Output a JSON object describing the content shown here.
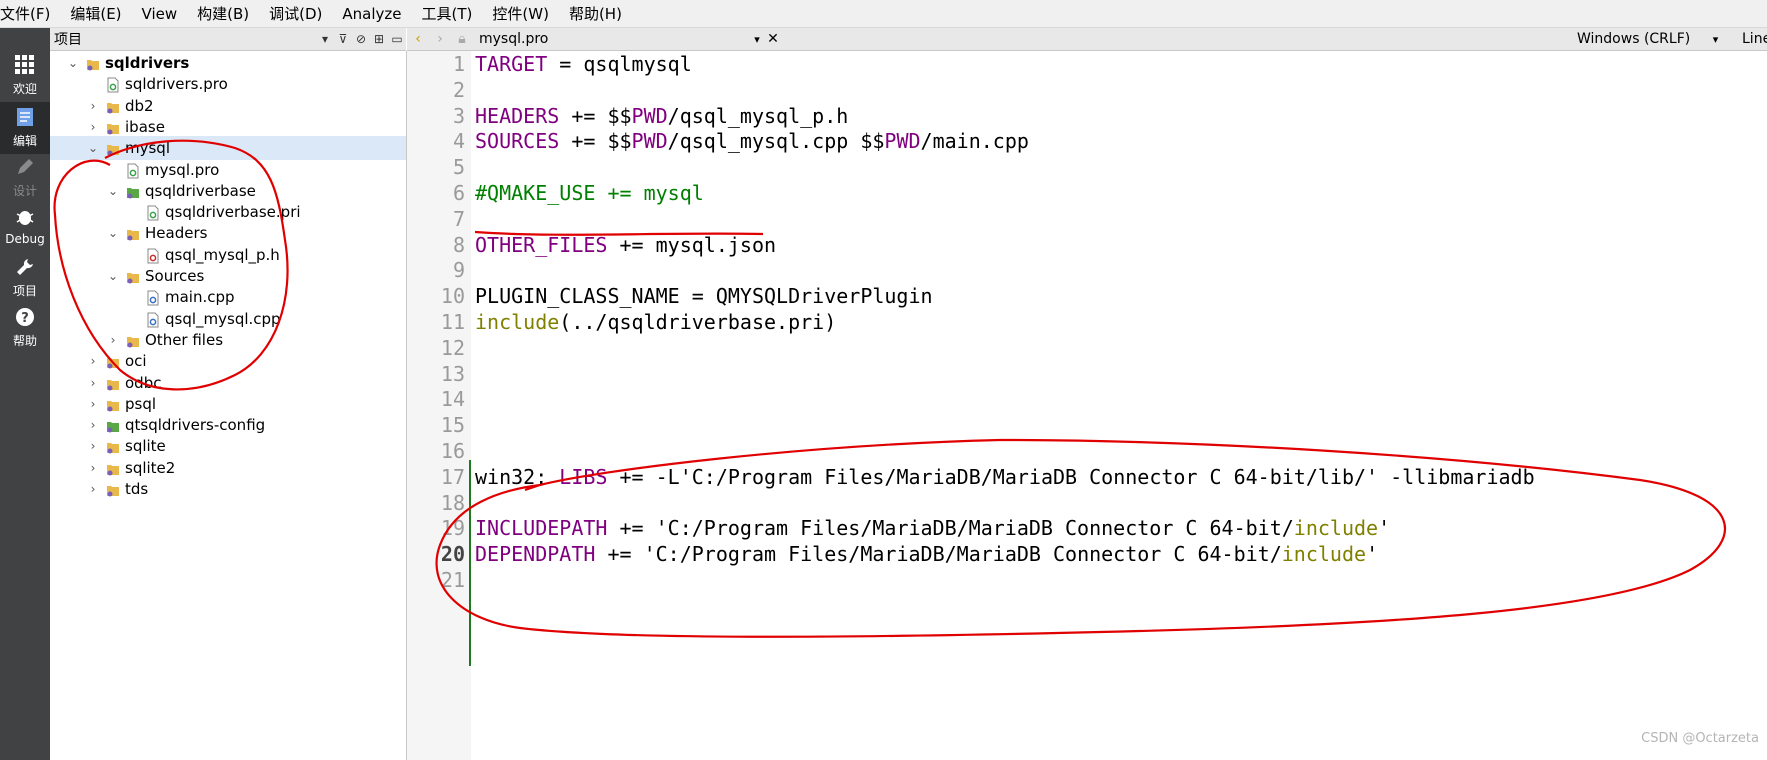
{
  "menu": [
    "文件(F)",
    "编辑(E)",
    "View",
    "构建(B)",
    "调试(D)",
    "Analyze",
    "工具(T)",
    "控件(W)",
    "帮助(H)"
  ],
  "modes": [
    {
      "label": "欢迎",
      "icon": "grid-icon"
    },
    {
      "label": "编辑",
      "icon": "document-icon"
    },
    {
      "label": "设计",
      "icon": "pencil-icon"
    },
    {
      "label": "Debug",
      "icon": "bug-icon"
    },
    {
      "label": "项目",
      "icon": "wrench-icon"
    },
    {
      "label": "帮助",
      "icon": "help-icon"
    }
  ],
  "project_panel": {
    "title": "项目",
    "tree": [
      {
        "label": "sqldrivers",
        "depth": 0,
        "expanded": true,
        "icon": "project-folder-icon"
      },
      {
        "label": "sqldrivers.pro",
        "depth": 1,
        "icon": "pro-file-icon"
      },
      {
        "label": "db2",
        "depth": 1,
        "expanded": false,
        "icon": "project-folder-icon"
      },
      {
        "label": "ibase",
        "depth": 1,
        "expanded": false,
        "icon": "project-folder-icon"
      },
      {
        "label": "mysql",
        "depth": 1,
        "expanded": true,
        "selected": true,
        "icon": "project-folder-icon"
      },
      {
        "label": "mysql.pro",
        "depth": 2,
        "icon": "pro-file-icon"
      },
      {
        "label": "qsqldriverbase",
        "depth": 2,
        "expanded": true,
        "icon": "pri-folder-icon"
      },
      {
        "label": "qsqldriverbase.pri",
        "depth": 3,
        "icon": "pri-file-icon"
      },
      {
        "label": "Headers",
        "depth": 2,
        "expanded": true,
        "icon": "headers-folder-icon"
      },
      {
        "label": "qsql_mysql_p.h",
        "depth": 3,
        "icon": "header-file-icon"
      },
      {
        "label": "Sources",
        "depth": 2,
        "expanded": true,
        "icon": "sources-folder-icon"
      },
      {
        "label": "main.cpp",
        "depth": 3,
        "icon": "cpp-file-icon"
      },
      {
        "label": "qsql_mysql.cpp",
        "depth": 3,
        "icon": "cpp-file-icon"
      },
      {
        "label": "Other files",
        "depth": 2,
        "expanded": false,
        "icon": "folder-icon"
      },
      {
        "label": "oci",
        "depth": 1,
        "expanded": false,
        "icon": "project-folder-icon"
      },
      {
        "label": "odbc",
        "depth": 1,
        "expanded": false,
        "icon": "project-folder-icon"
      },
      {
        "label": "psql",
        "depth": 1,
        "expanded": false,
        "icon": "project-folder-icon"
      },
      {
        "label": "qtsqldrivers-config",
        "depth": 1,
        "expanded": false,
        "icon": "pri-folder-icon"
      },
      {
        "label": "sqlite",
        "depth": 1,
        "expanded": false,
        "icon": "project-folder-icon"
      },
      {
        "label": "sqlite2",
        "depth": 1,
        "expanded": false,
        "icon": "project-folder-icon"
      },
      {
        "label": "tds",
        "depth": 1,
        "expanded": false,
        "icon": "project-folder-icon"
      }
    ]
  },
  "editor": {
    "filename": "mysql.pro",
    "line_ending": "Windows (CRLF)",
    "position_label": "Line",
    "current_line": 20,
    "lines": [
      [
        {
          "t": "TARGET",
          "c": "kw"
        },
        {
          "t": " = qsqlmysql"
        }
      ],
      [],
      [
        {
          "t": "HEADERS",
          "c": "kw"
        },
        {
          "t": " += $$"
        },
        {
          "t": "PWD",
          "c": "kw"
        },
        {
          "t": "/qsql_mysql_p.h"
        }
      ],
      [
        {
          "t": "SOURCES",
          "c": "kw"
        },
        {
          "t": " += $$"
        },
        {
          "t": "PWD",
          "c": "kw"
        },
        {
          "t": "/qsql_mysql.cpp $$"
        },
        {
          "t": "PWD",
          "c": "kw"
        },
        {
          "t": "/main.cpp"
        }
      ],
      [],
      [
        {
          "t": "#QMAKE_USE += mysql",
          "c": "cm"
        }
      ],
      [],
      [
        {
          "t": "OTHER_FILES",
          "c": "kw"
        },
        {
          "t": " += mysql.json"
        }
      ],
      [],
      [
        {
          "t": "PLUGIN_CLASS_NAME = QMYSQLDriverPlugin"
        }
      ],
      [
        {
          "t": "include",
          "c": "fn"
        },
        {
          "t": "(../qsqldriverbase.pri)"
        }
      ],
      [],
      [],
      [],
      [],
      [],
      [
        {
          "t": "win32: "
        },
        {
          "t": "LIBS",
          "c": "kw"
        },
        {
          "t": " += -L'C:/Program Files/MariaDB/MariaDB Connector C 64-bit/lib/' -llibmariadb"
        }
      ],
      [],
      [
        {
          "t": "INCLUDEPATH",
          "c": "kw"
        },
        {
          "t": " += 'C:/Program Files/MariaDB/MariaDB Connector C 64-bit/"
        },
        {
          "t": "include",
          "c": "fn"
        },
        {
          "t": "'"
        }
      ],
      [
        {
          "t": "DEPENDPATH",
          "c": "kw"
        },
        {
          "t": " += 'C:/Program Files/MariaDB/MariaDB Connector C 64-bit/"
        },
        {
          "t": "include",
          "c": "fn"
        },
        {
          "t": "'"
        }
      ],
      []
    ]
  },
  "watermark": "CSDN @Octarzeta",
  "colors": {
    "keyword": "#800080",
    "function": "#808000",
    "comment": "#008000",
    "annotation": "#e00000",
    "selection": "#dbe8f7"
  }
}
